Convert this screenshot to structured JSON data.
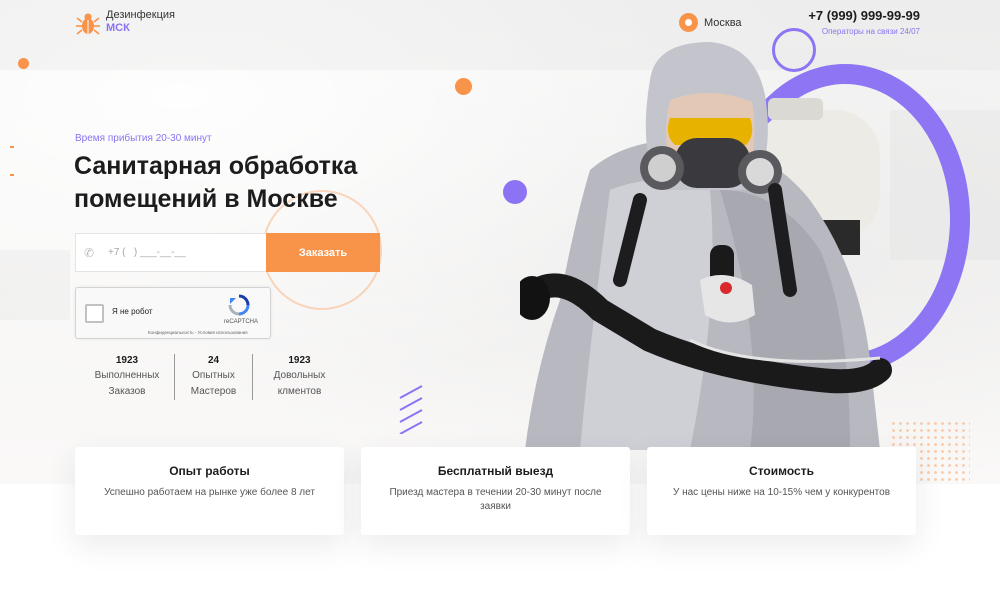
{
  "header": {
    "logo_line1": "Дезинфекция",
    "logo_line2": "МСК",
    "logo_icon": "bug-icon",
    "city": "Москва",
    "phone": "+7 (999) 999-99-99",
    "phone_note": "Операторы на связи 24/07"
  },
  "hero": {
    "arrival": "Время прибытия 20-30 минут",
    "title": "Санитарная обработка помещений в Москве",
    "phone_placeholder": "+7 (   ) ___-__-__",
    "order_button": "Заказать"
  },
  "captcha": {
    "label": "Я не робот",
    "brand": "reCAPTCHA",
    "terms": "Конфиденциальность - Условия использования"
  },
  "stats": [
    {
      "number": "1923",
      "label_line1": "Выполненных",
      "label_line2": "Заказов"
    },
    {
      "number": "24",
      "label_line1": "Опытных",
      "label_line2": "Мастеров"
    },
    {
      "number": "1923",
      "label_line1": "Довольных",
      "label_line2": "клментов"
    }
  ],
  "cards": [
    {
      "title": "Опыт работы",
      "text": "Успешно работаем на рынке уже более 8 лет"
    },
    {
      "title": "Бесплатный выезд",
      "text": "Приезд мастера в течении 20-30 минут после заявки"
    },
    {
      "title": "Стоимость",
      "text": "У нас цены ниже на 10-15% чем у конкурентов"
    }
  ],
  "colors": {
    "accent_orange": "#f8934a",
    "accent_purple": "#8b73f3",
    "text_dark": "#1c1c1c"
  }
}
